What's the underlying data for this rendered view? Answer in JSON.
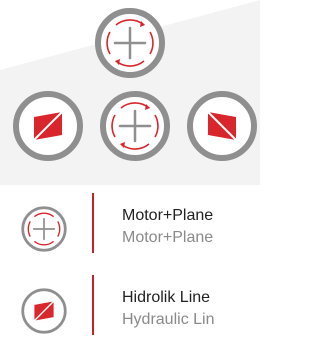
{
  "colors": {
    "ring": "#8f8f8f",
    "accent": "#d9262c",
    "divider": "#c8202a",
    "text_primary": "#222222",
    "text_secondary": "#8a8a8a",
    "background": "#ffffff"
  },
  "cluster": {
    "top_knob": {
      "icon": "rotate-plus-icon"
    },
    "left_knob": {
      "icon": "hydraulic-diamond-icon"
    },
    "center_knob": {
      "icon": "rotate-plus-icon"
    },
    "right_knob": {
      "icon": "hydraulic-diamond-icon"
    }
  },
  "legend": [
    {
      "icon": "rotate-plus-icon",
      "primary": "Motor+Plane",
      "secondary": "Motor+Plane"
    },
    {
      "icon": "hydraulic-diamond-icon",
      "primary": "Hidrolik Line",
      "secondary": "Hydraulic Lin"
    }
  ]
}
